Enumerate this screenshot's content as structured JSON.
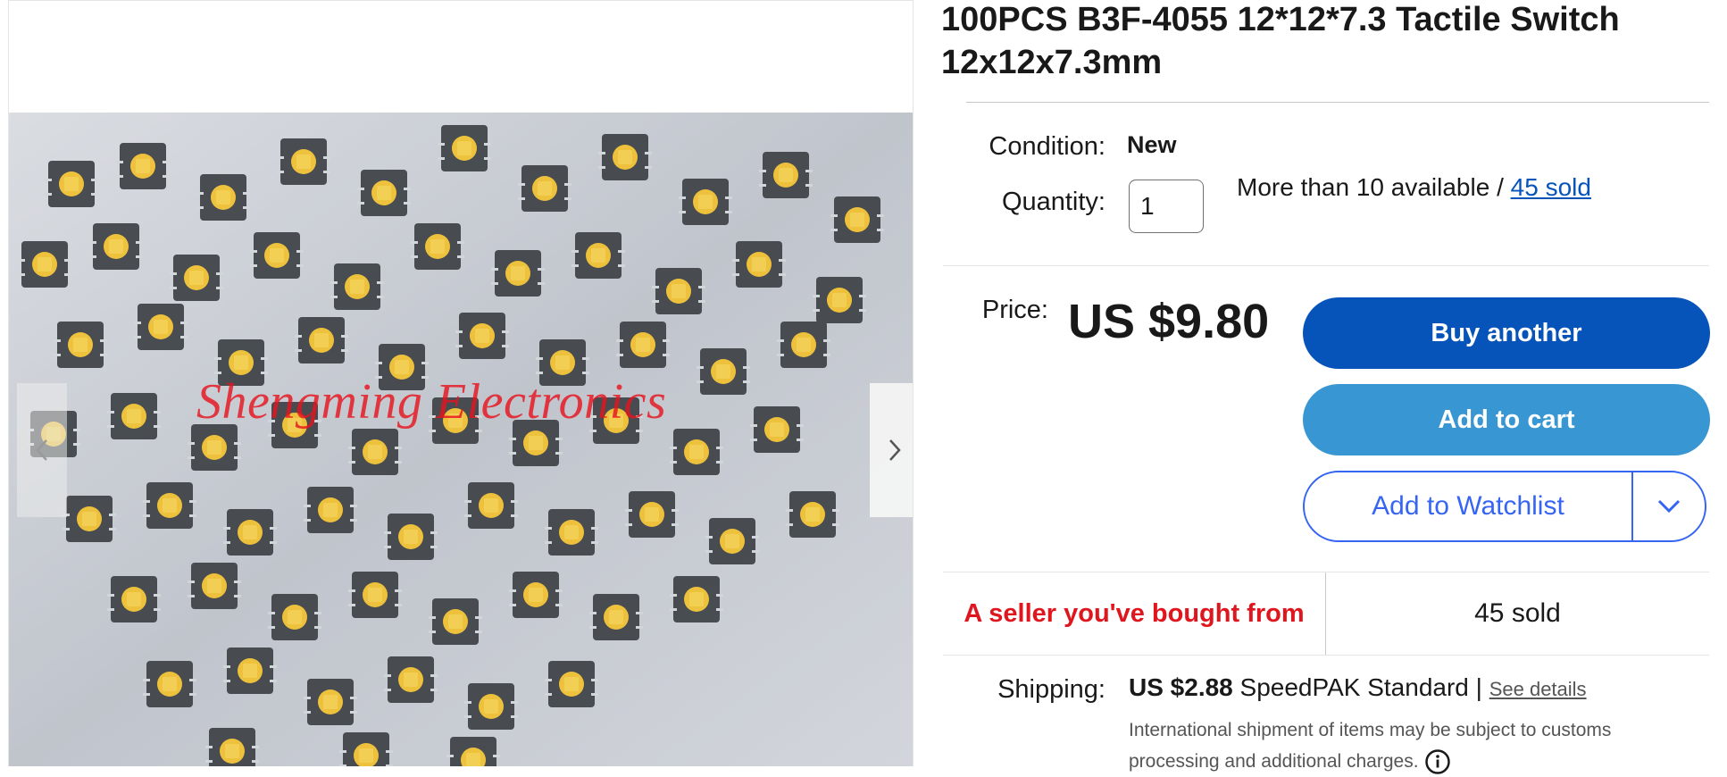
{
  "listing": {
    "title": "100PCS B3F-4055 12*12*7.3 Tactile Switch 12x12x7.3mm"
  },
  "gallery": {
    "watermark_text": "Shengming Electronics",
    "prev_icon": "chevron-left-icon",
    "next_icon": "chevron-right-icon"
  },
  "condition": {
    "label": "Condition:",
    "value": "New"
  },
  "quantity": {
    "label": "Quantity:",
    "value": "1",
    "availability_text": "More than 10 available / ",
    "sold_link": "45 sold"
  },
  "price": {
    "label": "Price:",
    "value": "US $9.80"
  },
  "actions": {
    "buy_label": "Buy another",
    "cart_label": "Add to cart",
    "watchlist_label": "Add to Watchlist",
    "watchlist_dropdown_icon": "chevron-down-icon"
  },
  "signal": {
    "seller_text": "A seller you've bought from",
    "sold_text": "45 sold"
  },
  "shipping": {
    "label": "Shipping:",
    "cost": "US $2.88",
    "service": " SpeedPAK Standard | ",
    "details_link": "See details",
    "note": "International shipment of items may be subject to customs processing and additional charges.",
    "info_icon": "info-icon"
  },
  "colors": {
    "primary_blue": "#0654ba",
    "cart_blue": "#3896d3",
    "link_blue": "#3665f3",
    "signal_red": "#e0161e"
  }
}
